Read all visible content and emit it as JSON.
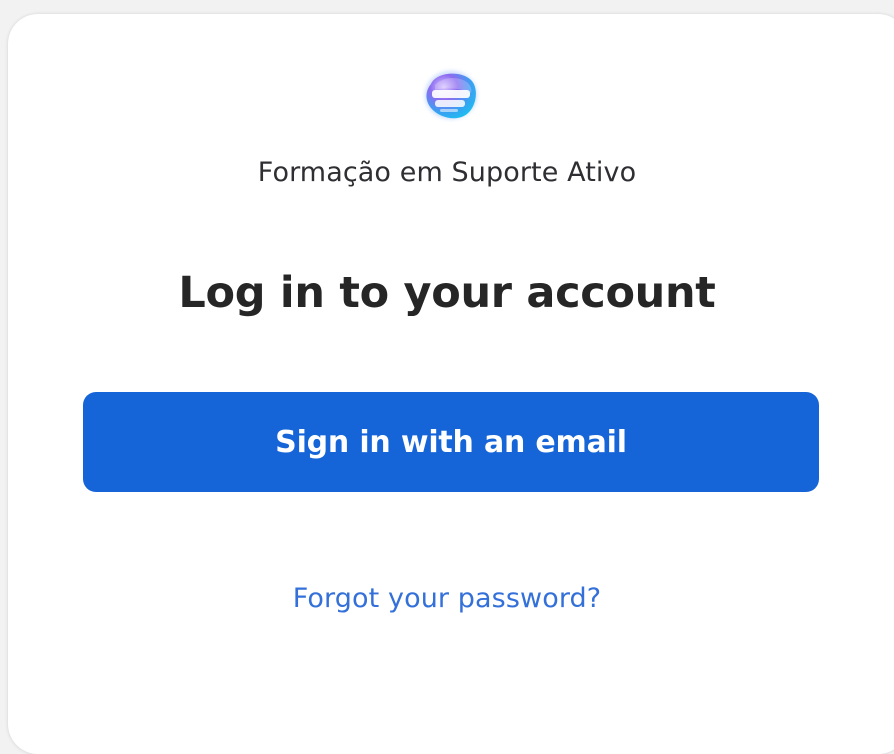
{
  "brand": {
    "logo_icon": "suporte-ativo-logo-icon",
    "org_name": "Formação em Suporte Ativo"
  },
  "login": {
    "heading": "Log in to your account",
    "email_button_label": "Sign in with an email",
    "forgot_password_label": "Forgot your password?"
  },
  "colors": {
    "primary_button": "#1565d8",
    "link": "#3470d9",
    "heading_text": "#262626",
    "card_background": "#ffffff",
    "page_background": "#f2f2f3"
  }
}
